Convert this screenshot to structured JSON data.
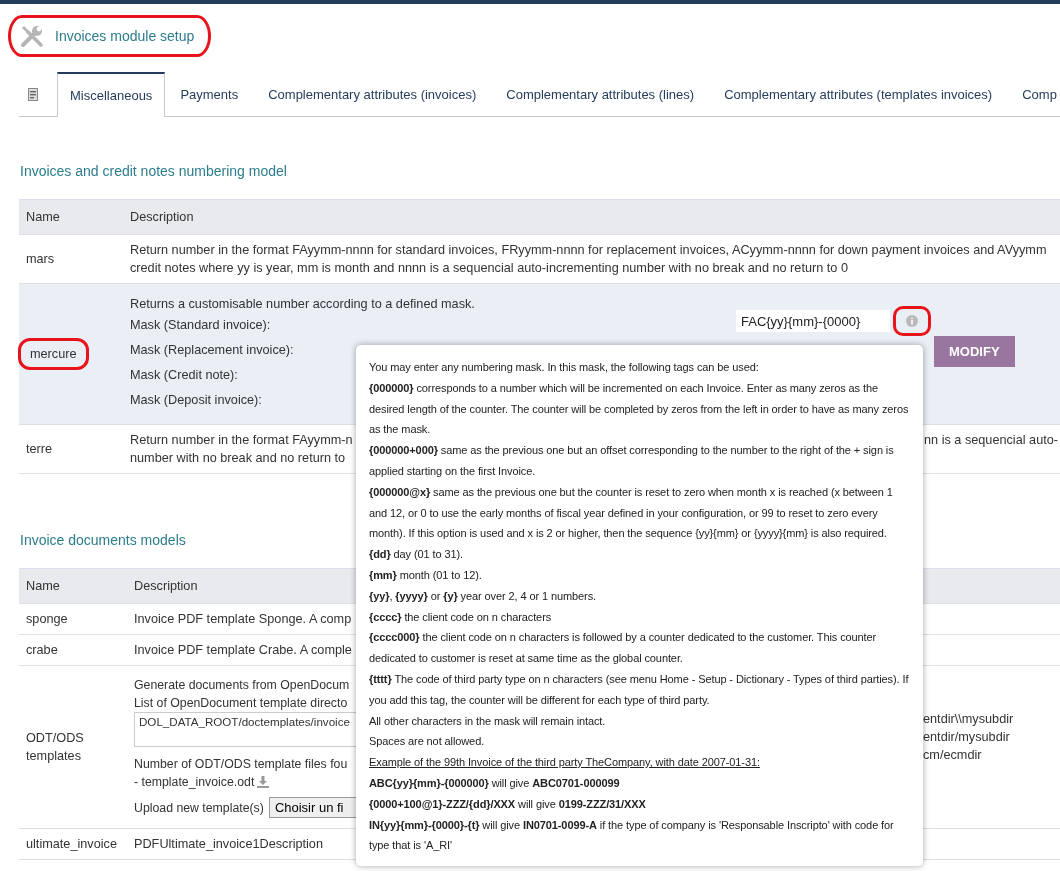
{
  "header": {
    "title": "Invoices module setup",
    "highlighted": true
  },
  "tabs": [
    {
      "kind": "icon",
      "selected": false
    },
    {
      "label": "Miscellaneous",
      "selected": true
    },
    {
      "label": "Payments",
      "selected": false
    },
    {
      "label": "Complementary attributes (invoices)",
      "selected": false
    },
    {
      "label": "Complementary attributes (lines)",
      "selected": false
    },
    {
      "label": "Complementary attributes (templates invoices)",
      "selected": false
    },
    {
      "label": "Comp",
      "selected": false
    }
  ],
  "numbering": {
    "title": "Invoices and credit notes numbering model",
    "columns": [
      "Name",
      "Description"
    ],
    "rows": [
      {
        "kind": "text",
        "name": "mars",
        "lines": [
          "Return number in the format FAyymm-nnnn for standard invoices, FRyymm-nnnn for replacement invoices, ACyymm-nnnn for down payment invoices and AVyymm",
          "credit notes where yy is year, mm is month and nnnn is a sequencial auto-incrementing number with no break and no return to 0"
        ]
      },
      {
        "kind": "mask",
        "name": "mercure",
        "highlighted": true,
        "intro": "Returns a customisable number according to a defined mask.",
        "masks": [
          "Mask (Standard invoice):",
          "Mask (Replacement invoice):",
          "Mask (Credit note):",
          "Mask (Deposit invoice):"
        ],
        "value": "FAC{yy}{mm}-{0000}",
        "info_highlighted": true,
        "button": "MODIFY"
      },
      {
        "kind": "text",
        "name": "terre",
        "lines": [
          "Return number in the format FAyymm-n",
          "number with no break and no return to"
        ],
        "right_fragment": "nn is a sequencial auto-"
      }
    ]
  },
  "documents": {
    "title": "Invoice documents models",
    "columns": [
      "Name",
      "Description"
    ],
    "rows": [
      {
        "kind": "text",
        "name": "sponge",
        "lines": [
          "Invoice PDF template Sponge. A comp"
        ]
      },
      {
        "kind": "text",
        "name": "crabe",
        "lines": [
          "Invoice PDF template Crabe. A comple"
        ]
      },
      {
        "kind": "odt",
        "name": "ODT/ODS templates",
        "lines": [
          "Generate documents from OpenDocum",
          "List of OpenDocument template directo"
        ],
        "directory": "DOL_DATA_ROOT/doctemplates/invoice",
        "found": "Number of ODT/ODS template files fou",
        "file": "- template_invoice.odt",
        "upload_label": "Upload new template(s)",
        "upload_button": "Choisir un fi",
        "examples": [
          "entdir\\\\mysubdir",
          "entdir/mysubdir",
          "cm/ecmdir"
        ]
      },
      {
        "kind": "text",
        "name": "ultimate_invoice",
        "lines": [
          "PDFUltimate_invoice1Description"
        ]
      }
    ]
  },
  "tooltip": {
    "paragraphs": [
      {
        "kind": "text",
        "text": "You may enter any numbering mask. In this mask, the following tags can be used:"
      },
      {
        "kind": "text",
        "text": "**{000000}** corresponds to a number which will be incremented on each Invoice. Enter as many zeros as the desired length of the counter. The counter will be completed by zeros from the left in order to have as many zeros as the mask."
      },
      {
        "kind": "text",
        "text": "**{000000+000}** same as the previous one but an offset corresponding to the number to the right of the + sign is applied starting on the first Invoice."
      },
      {
        "kind": "text",
        "text": "**{000000@x}** same as the previous one but the counter is reset to zero when month x is reached (x between 1 and 12, or 0 to use the early months of fiscal year defined in your configuration, or 99 to reset to zero every month). If this option is used and x is 2 or higher, then the sequence {yy}{mm} or {yyyy}{mm} is also required."
      },
      {
        "kind": "text",
        "text": "**{dd}** day (01 to 31)."
      },
      {
        "kind": "text",
        "text": "**{mm}** month (01 to 12)."
      },
      {
        "kind": "text",
        "text": "**{yy}**, **{yyyy}** or **{y}** year over 2, 4 or 1 numbers."
      },
      {
        "kind": "text",
        "text": "**{cccc}** the client code on n characters"
      },
      {
        "kind": "text",
        "text": "**{cccc000}** the client code on n characters is followed by a counter dedicated to the customer. This counter dedicated to customer is reset at same time as the global counter."
      },
      {
        "kind": "text",
        "text": "**{tttt}** The code of third party type on n characters (see menu Home - Setup - Dictionary - Types of third parties). If you add this tag, the counter will be different for each type of third party."
      },
      {
        "kind": "text",
        "text": "All other characters in the mask will remain intact."
      },
      {
        "kind": "text",
        "text": "Spaces are not allowed."
      },
      {
        "kind": "heading",
        "text": "Example of the 99th Invoice of the third party TheCompany, with date 2007-01-31:"
      },
      {
        "kind": "text",
        "text": "**ABC{yy}{mm}-{000000}** will give **ABC0701-000099**"
      },
      {
        "kind": "text",
        "text": "**{0000+100@1}-ZZZ/{dd}/XXX** will give **0199-ZZZ/31/XXX**"
      },
      {
        "kind": "text",
        "text": "**IN{yy}{mm}-{0000}-{t}** will give **IN0701-0099-A** if the type of company is 'Responsable Inscripto' with code for type that is 'A_RI'"
      }
    ]
  }
}
